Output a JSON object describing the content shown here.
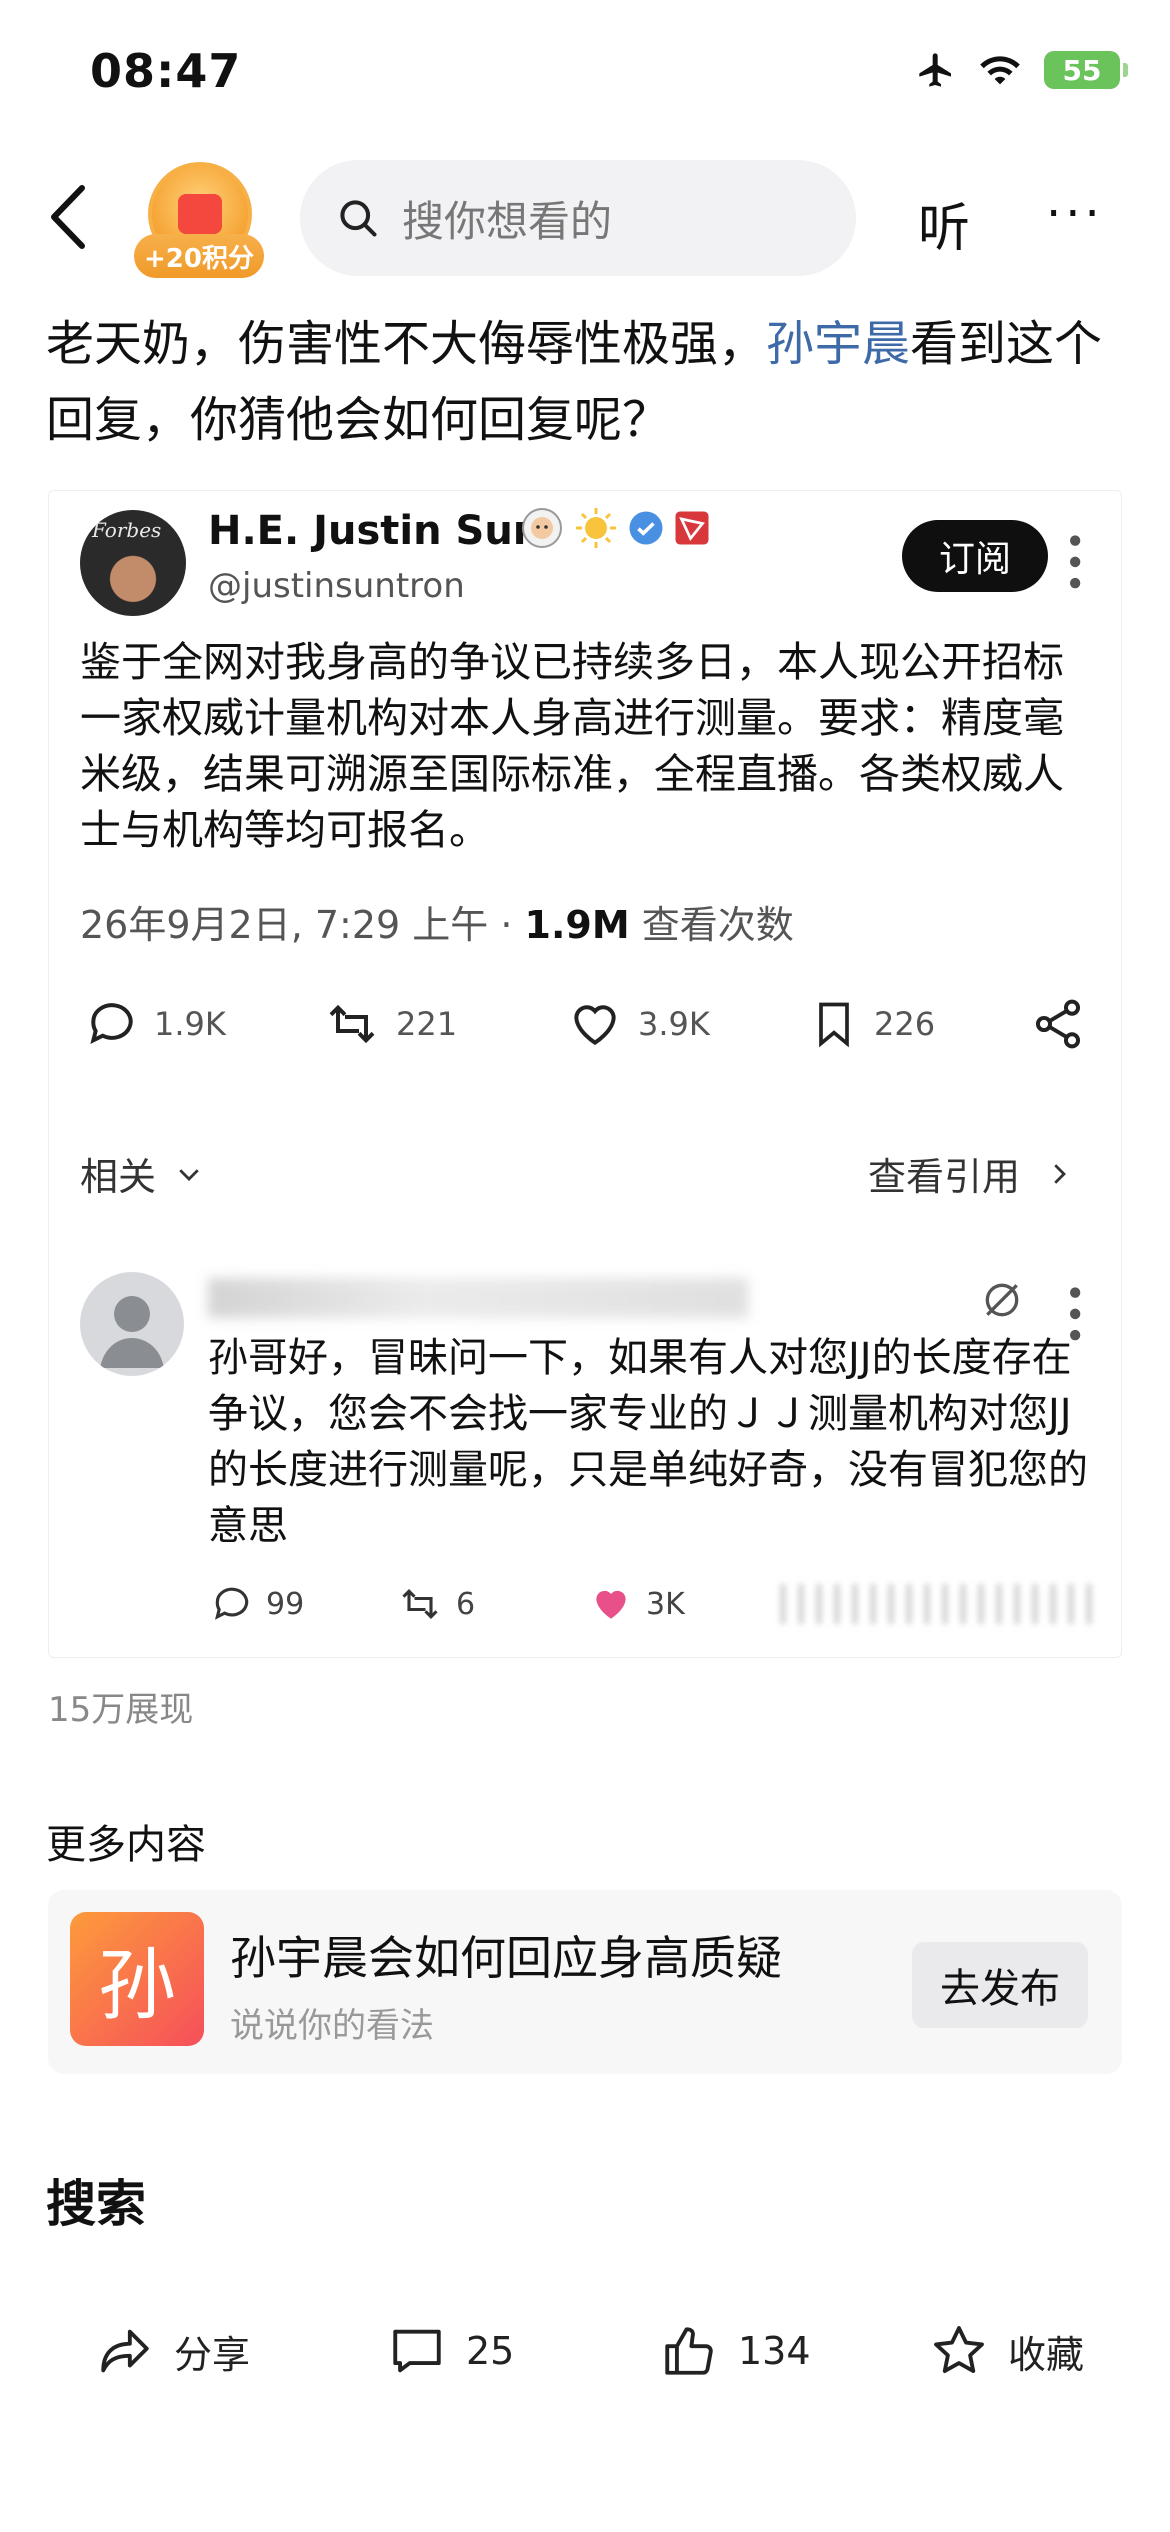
{
  "status_bar": {
    "time": "08:47",
    "battery": "55"
  },
  "nav": {
    "points_label": "+20积分",
    "search_placeholder": "搜你想看的",
    "listen_label": "听",
    "more_label": "···"
  },
  "post": {
    "title_prefix": "老天奶，伤害性不大侮辱性极强，",
    "title_link": "孙宇晨",
    "title_suffix": "看到这个回复，你猜他会如何回复呢？"
  },
  "tweet": {
    "author_name": "H.E. Justin Sun",
    "avatar_text": "Forbes",
    "handle": "@justinsuntron",
    "subscribe_label": "订阅",
    "body": "鉴于全网对我身高的争议已持续多日，本人现公开招标一家权威计量机构对本人身高进行测量。要求：精度毫米级，结果可溯源至国际标准，全程直播。各类权威人士与机构等均可报名。",
    "date": "26年9月2日, 7:29 上午 · ",
    "views_count": "1.9M",
    "views_label": " 查看次数",
    "actions": {
      "replies": "1.9K",
      "retweets": "221",
      "likes": "3.9K",
      "bookmarks": "226"
    },
    "related_label": "相关",
    "quotes_label": "查看引用"
  },
  "reply": {
    "body": "孙哥好，冒昧问一下，如果有人对您JJ的长度存在争议，您会不会找一家专业的ＪＪ测量机构对您JJ的长度进行测量呢，只是单纯好奇，没有冒犯您的意思",
    "actions": {
      "replies": "99",
      "retweets": "6",
      "likes": "3K"
    }
  },
  "impressions": "15万展现",
  "more_content": {
    "title": "更多内容",
    "topic_icon_char": "孙",
    "topic_title": "孙宇晨会如何回应身高质疑",
    "topic_sub": "说说你的看法",
    "publish_label": "去发布"
  },
  "search_section": {
    "title": "搜索"
  },
  "bottom_bar": {
    "share_label": "分享",
    "comments_count": "25",
    "likes_count": "134",
    "favorite_label": "收藏"
  },
  "colors": {
    "link": "#3f6aa8",
    "like_pink": "#e8508a",
    "badge_orange": "#f5a232",
    "verified_blue": "#4a90e2"
  }
}
